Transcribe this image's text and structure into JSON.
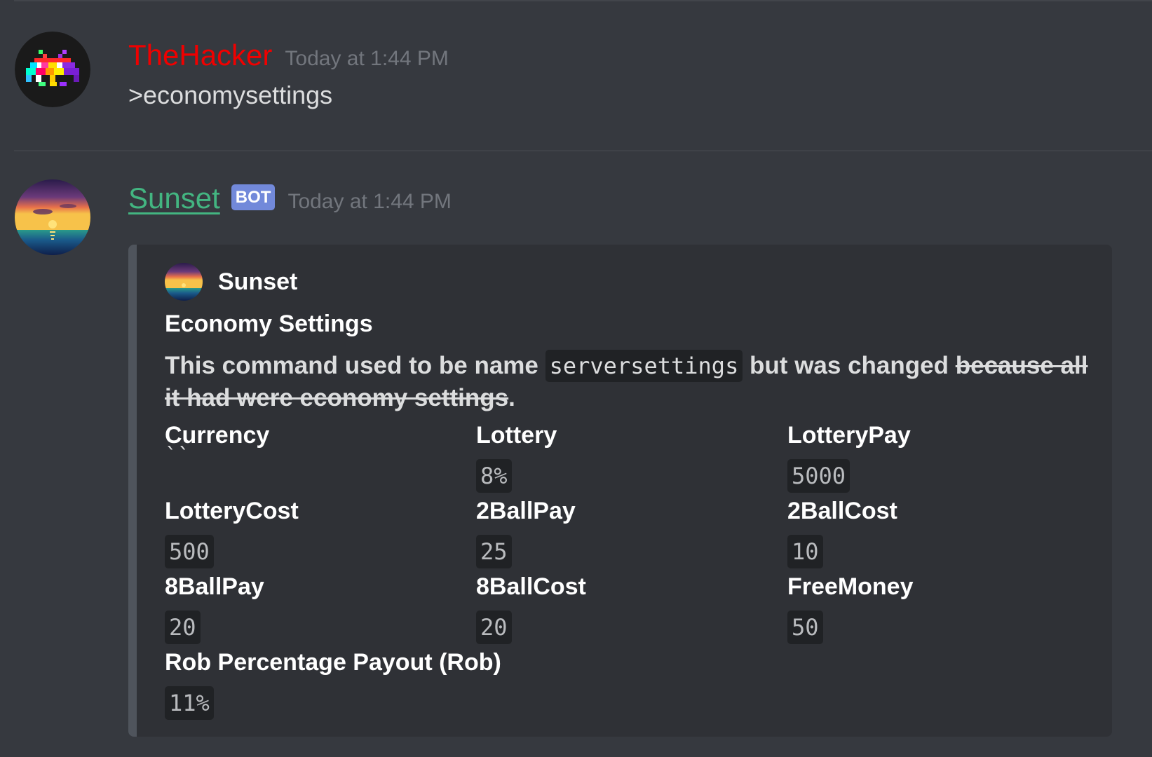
{
  "messages": [
    {
      "username": "TheHacker",
      "timestamp": "Today at 1:44 PM",
      "content": ">economysettings",
      "avatar_icon": "space-invader-avatar"
    },
    {
      "username": "Sunset",
      "bot_tag": "BOT",
      "timestamp": "Today at 1:44 PM",
      "avatar_icon": "sunset-avatar",
      "embed": {
        "author": "Sunset",
        "title": "Economy Settings",
        "description": {
          "part1": "This command used to be name ",
          "code": "serversettings",
          "part2": " but was changed ",
          "strike": "because all it had were economy settings",
          "end": "."
        },
        "fields": [
          {
            "name": "Currency",
            "value": "``",
            "empty": true
          },
          {
            "name": "Lottery",
            "value": "8%"
          },
          {
            "name": "LotteryPay",
            "value": "5000"
          },
          {
            "name": "LotteryCost",
            "value": "500"
          },
          {
            "name": "2BallPay",
            "value": "25"
          },
          {
            "name": "2BallCost",
            "value": "10"
          },
          {
            "name": "8BallPay",
            "value": "20"
          },
          {
            "name": "8BallCost",
            "value": "20"
          },
          {
            "name": "FreeMoney",
            "value": "50"
          },
          {
            "name": "Rob Percentage Payout (Rob)",
            "value": "11%"
          }
        ]
      }
    }
  ],
  "colors": {
    "background": "#36393f",
    "embed_background": "#2f3136",
    "user_red": "#f00000",
    "bot_teal": "#43b581",
    "bot_tag": "#7289da"
  }
}
